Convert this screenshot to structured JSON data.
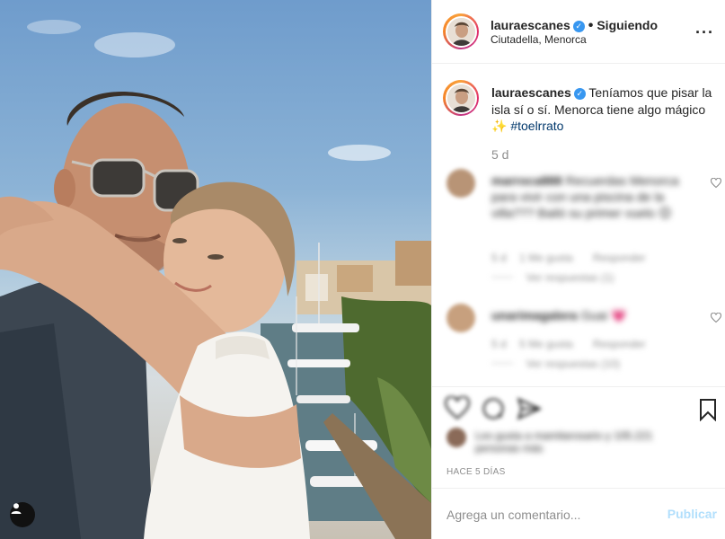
{
  "post": {
    "username": "lauraescanes",
    "follow_status": "Siguiendo",
    "location": "Ciutadella, Menorca",
    "more_icon": "more-dots-icon"
  },
  "caption": {
    "username": "lauraescanes",
    "text": "Teníamos que pisar la isla sí o sí. Menorca tiene algo mágico",
    "emoji": "✨",
    "hashtag": "#toelrrato",
    "time_ago": "5 d"
  },
  "comments": [
    {
      "username": "marroca888",
      "text": "Recuerdas Menorca para vivir con una piscina de la villa??? Bailó su primer vuelo",
      "emoji": "😊",
      "meta_likes": "1 Me gusta",
      "meta_reply": "Responder",
      "meta_time": "5 d",
      "replies": "Ver respuestas (1)"
    },
    {
      "username": "unarimagalera",
      "text": "Guai",
      "emoji": "💗",
      "meta_likes": "5 Me gusta",
      "meta_reply": "Responder",
      "meta_time": "5 d",
      "replies": "Ver respuestas (10)"
    }
  ],
  "likes_text": "Les gusta a mamitarosario y 105.221 personas más",
  "posted_ago": "HACE 5 DÍAS",
  "comment_bar": {
    "placeholder": "Agrega un comentario...",
    "publish_label": "Publicar"
  },
  "colors": {
    "link": "#00376b",
    "verified": "#3897f0",
    "publish_disabled": "#b2dffc",
    "muted": "#8e8e8e"
  }
}
